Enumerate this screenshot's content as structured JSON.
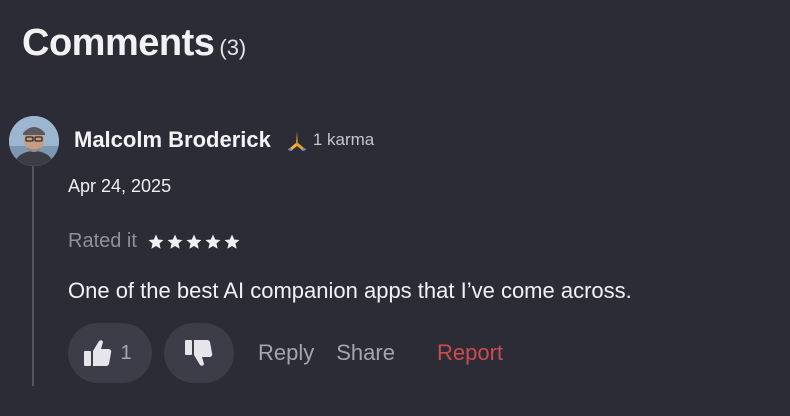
{
  "header": {
    "title": "Comments",
    "count": "(3)"
  },
  "comment": {
    "author": "Malcolm Broderick",
    "karma_icon": "praying-hands-icon",
    "karma": "1 karma",
    "date": "Apr 24, 2025",
    "rating_label": "Rated it",
    "rating": 5,
    "rating_max": 5,
    "body": "One of the best AI companion apps that I’ve come across.",
    "likes": "1",
    "actions": {
      "reply": "Reply",
      "share": "Share",
      "report": "Report"
    }
  },
  "colors": {
    "background": "#2c2c36",
    "pill": "#3d3d4a",
    "report": "#cc4b4f",
    "muted": "#a4a4ae"
  }
}
